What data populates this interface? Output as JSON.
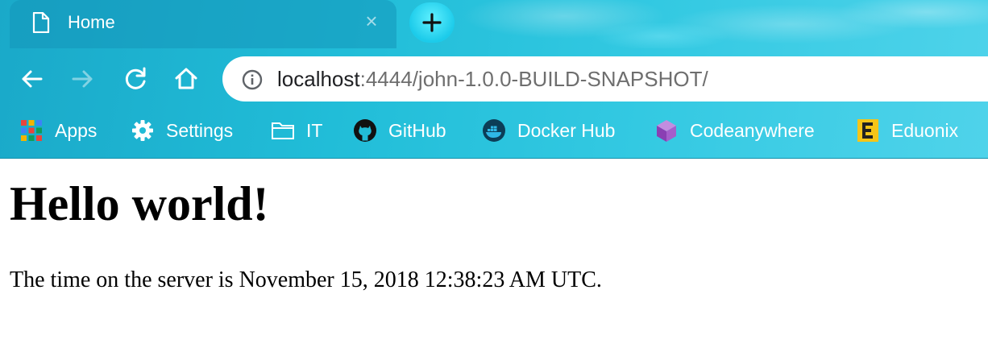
{
  "tab": {
    "title": "Home",
    "close_glyph": "×"
  },
  "toolbar": {
    "icons": [
      "back-arrow-icon",
      "forward-arrow-icon",
      "reload-icon",
      "home-icon"
    ]
  },
  "address_bar": {
    "host": "localhost",
    "rest": ":4444/john-1.0.0-BUILD-SNAPSHOT/"
  },
  "bookmarks": [
    {
      "label": "Apps",
      "icon": "apps-grid-icon"
    },
    {
      "label": "Settings",
      "icon": "gear-icon"
    },
    {
      "label": "IT",
      "icon": "folder-icon"
    },
    {
      "label": "GitHub",
      "icon": "github-icon"
    },
    {
      "label": "Docker Hub",
      "icon": "docker-icon"
    },
    {
      "label": "Codeanywhere",
      "icon": "codeanywhere-cube-icon"
    },
    {
      "label": "Eduonix",
      "icon": "eduonix-icon"
    }
  ],
  "page": {
    "heading": "Hello world!",
    "server_time": "The time on the server is November 15, 2018 12:38:23 AM UTC."
  },
  "colors": {
    "chrome": "#21bdd8",
    "text_on_chrome": "#ffffff",
    "url_host": "#202124",
    "url_rest": "#6e6e6e",
    "page_text": "#000000"
  }
}
